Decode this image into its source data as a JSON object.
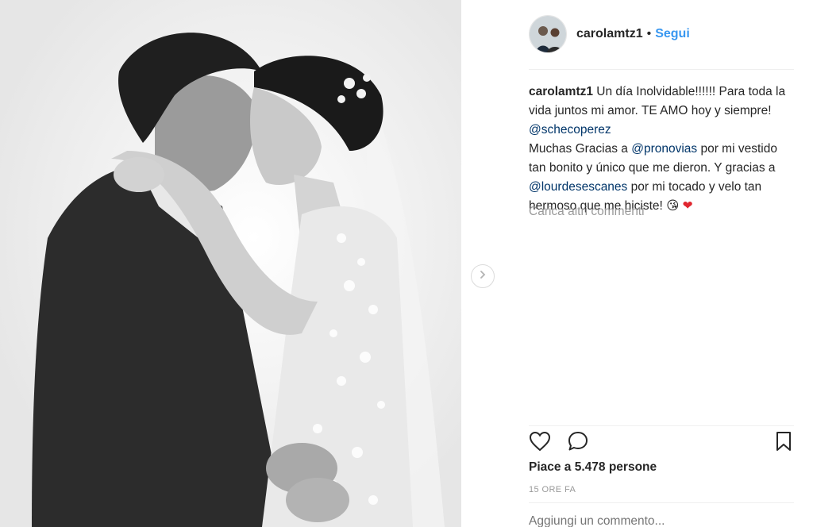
{
  "post": {
    "username": "carolamtz1",
    "dot": "•",
    "follow_label": "Segui",
    "caption": {
      "author": "carolamtz1",
      "line1_text": " Un día Inolvidable!!!!!! Para toda la vida juntos mi amor. TE AMO hoy y siempre! ",
      "mention1": "@schecoperez",
      "line2_text": "Muchas Gracias a ",
      "mention2": "@pronovias",
      "line3_text": " por mi vestido tan bonito y único que me dieron. Y gracias a ",
      "mention3": "@lourdesescanes",
      "line4_text": " por mi tocado y velo tan hermoso que me hiciste! ",
      "emoji1": "😘",
      "emoji2": "❤"
    },
    "load_more_label": "Carica altri commenti",
    "likes_text": "Piace a 5.478 persone",
    "time_ago": "15 ORE FA",
    "comment_placeholder": "Aggiungi un commento..."
  },
  "icons": {
    "like": "heart-icon",
    "comment": "comment-icon",
    "save": "bookmark-icon",
    "next": "chevron-right-icon"
  }
}
